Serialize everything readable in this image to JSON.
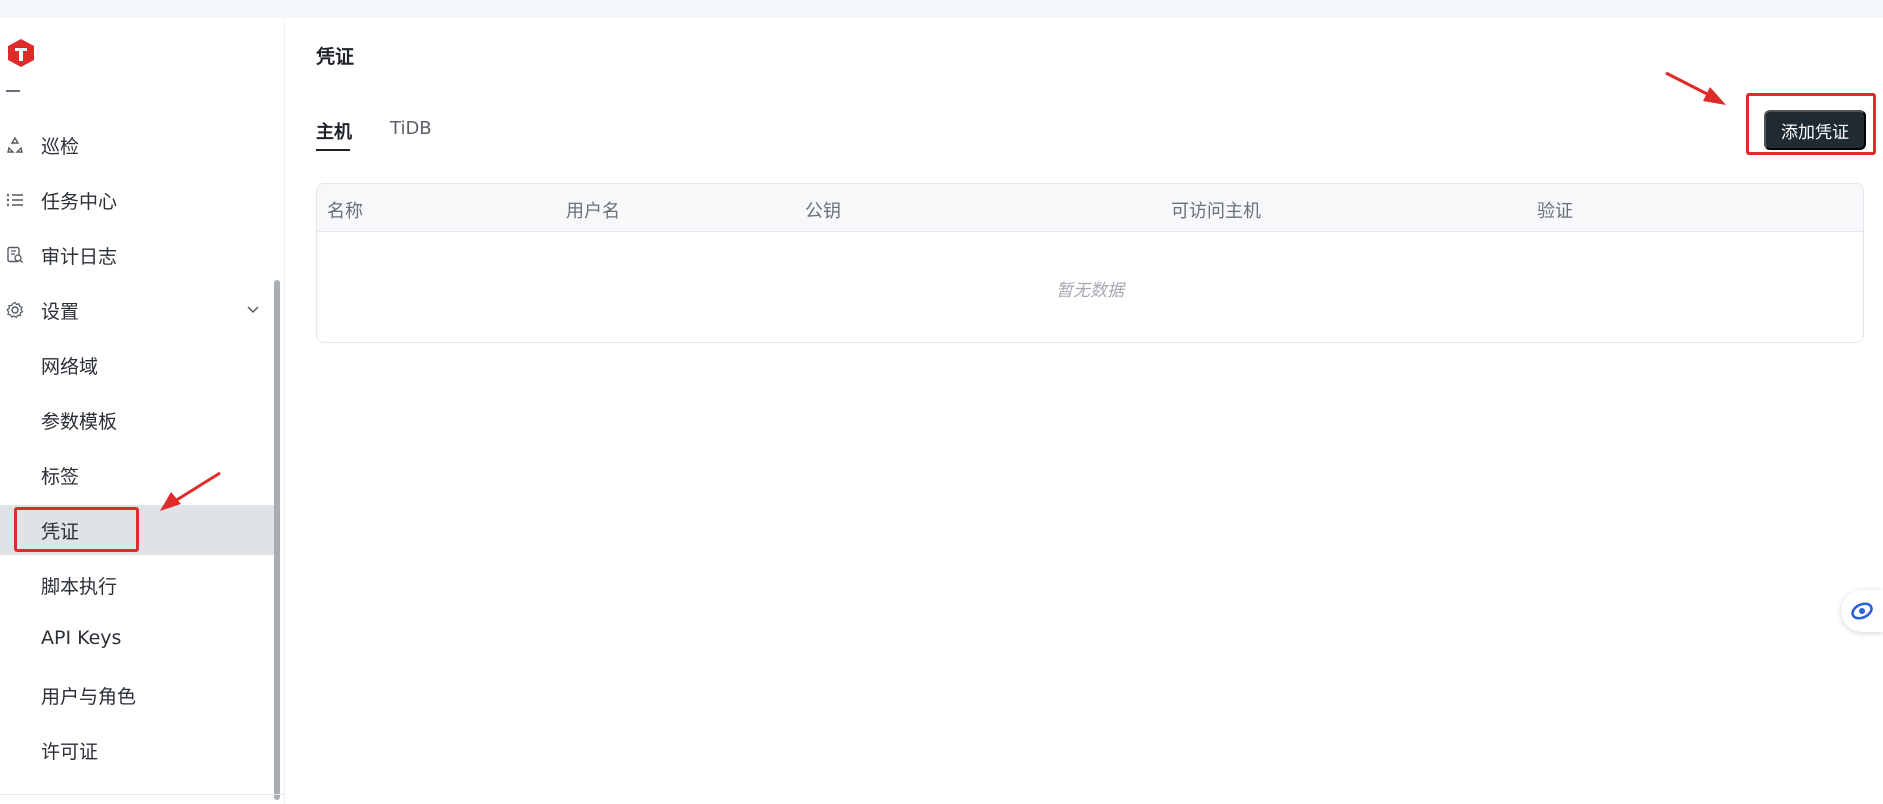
{
  "app": {
    "logo": "tidb-logo"
  },
  "sidebar": {
    "items": [
      {
        "label": "巡检",
        "icon": "recycle-icon"
      },
      {
        "label": "任务中心",
        "icon": "list-icon"
      },
      {
        "label": "审计日志",
        "icon": "audit-log-icon"
      },
      {
        "label": "设置",
        "icon": "gear-icon",
        "expanded": true
      }
    ],
    "sub_items": [
      {
        "label": "网络域"
      },
      {
        "label": "参数模板"
      },
      {
        "label": "标签"
      },
      {
        "label": "凭证",
        "active": true
      },
      {
        "label": "脚本执行"
      },
      {
        "label": "API Keys"
      },
      {
        "label": "用户与角色"
      },
      {
        "label": "许可证"
      }
    ]
  },
  "page": {
    "title": "凭证",
    "tabs": [
      {
        "label": "主机",
        "active": true
      },
      {
        "label": "TiDB",
        "active": false
      }
    ],
    "add_button": "添加凭证"
  },
  "table": {
    "columns": [
      "名称",
      "用户名",
      "公钥",
      "可访问主机",
      "验证"
    ],
    "empty_text": "暂无数据"
  },
  "colors": {
    "annotation": "#e02b2b",
    "primary_button": "#1f2a33",
    "active_menu": "#dfe3e7",
    "logo": "#e02b2b"
  }
}
